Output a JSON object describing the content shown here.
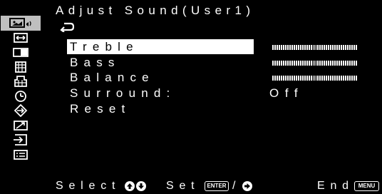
{
  "title": "Adjust Sound(User1)",
  "sidebar": {
    "items": [
      {
        "icon": "picture-sound-icon",
        "active": true
      },
      {
        "icon": "geometry-icon"
      },
      {
        "icon": "pip-window-icon"
      },
      {
        "icon": "color-adjust-icon"
      },
      {
        "icon": "color-palette-icon"
      },
      {
        "icon": "clock-icon"
      },
      {
        "icon": "direction-setup-icon"
      },
      {
        "icon": "signal-icon"
      },
      {
        "icon": "input-select-icon"
      },
      {
        "icon": "information-icon"
      }
    ]
  },
  "menu": {
    "back_icon": "return-arrow-icon",
    "items": [
      {
        "label": "Treble",
        "selected": true,
        "type": "slider",
        "value": 0.5
      },
      {
        "label": "Bass",
        "type": "slider",
        "value": 0.5
      },
      {
        "label": "Balance",
        "type": "slider",
        "value": 0.5
      },
      {
        "label": "Surround:",
        "type": "value",
        "value": "Off"
      },
      {
        "label": "Reset",
        "type": "action"
      }
    ]
  },
  "footer": {
    "select_label": "Select",
    "select_keys": [
      "up-arrow-icon",
      "down-arrow-icon"
    ],
    "set_label": "Set",
    "enter_key": "ENTER",
    "separator": "/",
    "set_arrow": "right-arrow-icon",
    "end_label": "End",
    "menu_key": "MENU"
  },
  "colors": {
    "background": "#000000",
    "text": "#ffffff",
    "active_icon_bg": "#bfbfbf"
  }
}
